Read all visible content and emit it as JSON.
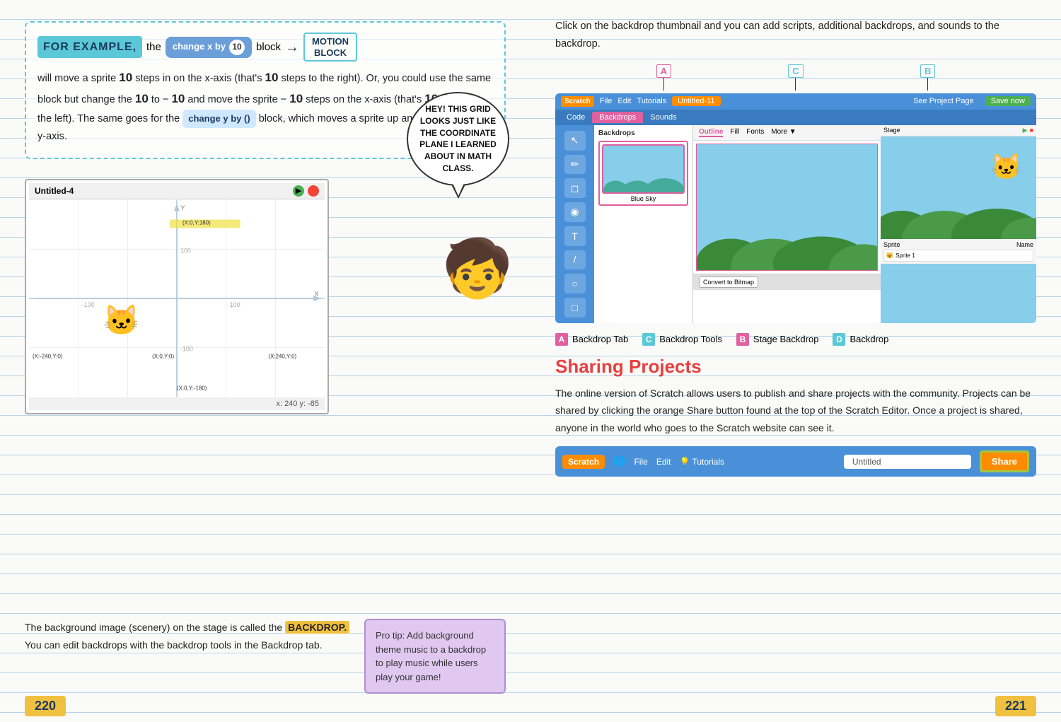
{
  "left_page": {
    "for_example_label": "FOR EXAMPLE,",
    "for_example_intro": "the",
    "code_block_text": "change x by",
    "code_block_num": "10",
    "arrow_label": "→",
    "motion_block_line1": "MOTION",
    "motion_block_line2": "BLOCK",
    "body_text_1": "will move a sprite",
    "num1": "10",
    "body_text_2": "steps in on the x-axis (that's",
    "num2": "10",
    "body_text_3": "steps to the right). Or, you could use the same block but change the",
    "num3": "10",
    "body_text_4": "to −",
    "num4": "10",
    "body_text_5": "and move the sprite −",
    "num5": "10",
    "body_text_6": "steps on the x-axis (that's",
    "num6": "10",
    "body_text_7": "steps to the left). The same goes for the",
    "change_y_block": "change y by ()",
    "body_text_8": "block, which moves a sprite up and down along the y-axis.",
    "grid_title": "Untitled-4",
    "grid_coord_tl": "(X:-240,Y:0)",
    "grid_coord_c": "(X:0,Y:0)",
    "grid_coord_tr": "(X:240,Y:0)",
    "grid_coord_top": "(X:0,Y:180)",
    "grid_coord_bot": "(X:0,Y:-180)",
    "grid_footer": "x: 240  y: -85",
    "speech_bubble": "HEY! THIS GRID LOOKS JUST LIKE THE COORDINATE PLANE I LEARNED ABOUT IN MATH CLASS.",
    "backdrop_text_1": "The background image (scenery) on the stage is called the",
    "backdrop_word": "BACKDROP.",
    "backdrop_text_2": "You can edit backdrops with the backdrop tools in the Backdrop tab.",
    "pro_tip": "Pro tip: Add background theme music to a backdrop to play music while users play your game!",
    "page_number": "220"
  },
  "right_page": {
    "intro_text": "Click on the backdrop thumbnail and you can add scripts, additional backdrops, and sounds to the backdrop.",
    "label_a": "A",
    "label_a_text": "Backdrop Tab",
    "label_b": "B",
    "label_b_text": "Stage Backdrop",
    "label_c": "C",
    "label_c_text": "Backdrop Tools",
    "label_d": "D",
    "label_d_text": "Backdrop",
    "sharing_title": "Sharing Projects",
    "sharing_text": "The online version of Scratch allows users to publish and share projects with the community. Projects can be shared by clicking the orange Share button found at the top of the Scratch Editor. Once a project is shared, anyone in the world who goes to the Scratch website can see it.",
    "editor_logo": "Scratch",
    "editor_menu": [
      "File",
      "Edit",
      "Tutorials"
    ],
    "editor_title": "Untitled-11",
    "editor_tab1": "Code",
    "editor_tab2": "Backdrops",
    "editor_tab3": "Sounds",
    "editor_tab_active": "Backdrops",
    "share_input_value": "Untitled",
    "share_button_label": "Share",
    "see_project": "See Project Page",
    "save_now": "Save now",
    "backdrop_tab_label": "Blue Sky",
    "page_number": "221"
  }
}
